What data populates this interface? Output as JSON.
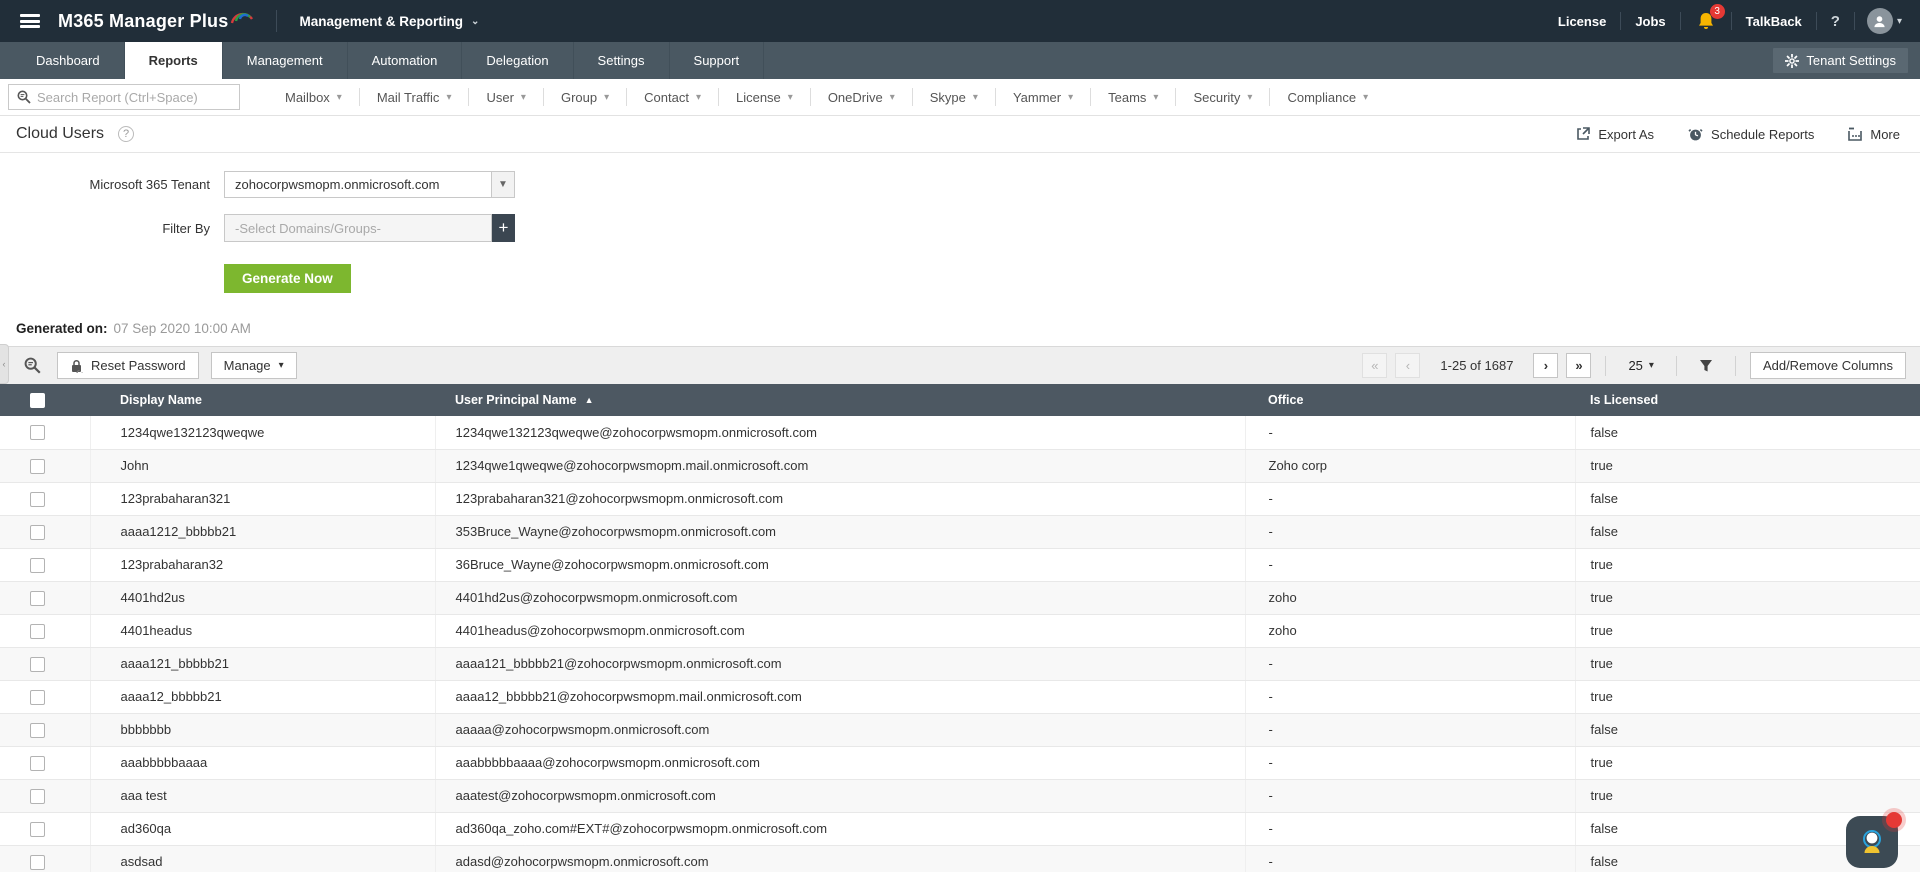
{
  "topbar": {
    "app_name": "M365 Manager Plus",
    "context_menu": "Management & Reporting",
    "license": "License",
    "jobs": "Jobs",
    "notification_count": "3",
    "talkback": "TalkBack",
    "help": "?"
  },
  "tabbar": {
    "tabs": [
      {
        "label": "Dashboard",
        "active": false
      },
      {
        "label": "Reports",
        "active": true
      },
      {
        "label": "Management",
        "active": false
      },
      {
        "label": "Automation",
        "active": false
      },
      {
        "label": "Delegation",
        "active": false
      },
      {
        "label": "Settings",
        "active": false
      },
      {
        "label": "Support",
        "active": false
      }
    ],
    "tenant_settings": "Tenant Settings"
  },
  "menubar": {
    "search_placeholder": "Search Report (Ctrl+Space)",
    "menus": [
      "Mailbox",
      "Mail Traffic",
      "User",
      "Group",
      "Contact",
      "License",
      "OneDrive",
      "Skype",
      "Yammer",
      "Teams",
      "Security",
      "Compliance"
    ]
  },
  "page": {
    "title": "Cloud Users",
    "export_as": "Export As",
    "schedule_reports": "Schedule Reports",
    "more": "More"
  },
  "form": {
    "tenant_label": "Microsoft 365 Tenant",
    "tenant_value": "zohocorpwsmopm.onmicrosoft.com",
    "filter_label": "Filter By",
    "filter_placeholder": "-Select Domains/Groups-",
    "generate_button": "Generate Now"
  },
  "generated": {
    "label": "Generated on:",
    "value": "07 Sep 2020 10:00 AM"
  },
  "toolbar": {
    "reset_password": "Reset Password",
    "manage": "Manage",
    "pagination_info": "1-25 of 1687",
    "page_size": "25",
    "add_remove_columns": "Add/Remove Columns"
  },
  "table": {
    "columns": {
      "display_name": "Display Name",
      "user_principal_name": "User Principal Name",
      "office": "Office",
      "is_licensed": "Is Licensed"
    },
    "sorted_by": "User Principal Name",
    "sort_direction": "asc",
    "rows": [
      {
        "display_name": "1234qwe132123qweqwe",
        "user_principal_name": "1234qwe132123qweqwe@zohocorpwsmopm.onmicrosoft.com",
        "office": "-",
        "is_licensed": "false"
      },
      {
        "display_name": "John",
        "user_principal_name": "1234qwe1qweqwe@zohocorpwsmopm.mail.onmicrosoft.com",
        "office": "Zoho corp",
        "is_licensed": "true"
      },
      {
        "display_name": "123prabaharan321",
        "user_principal_name": "123prabaharan321@zohocorpwsmopm.onmicrosoft.com",
        "office": "-",
        "is_licensed": "false"
      },
      {
        "display_name": "aaaa1212_bbbbb21",
        "user_principal_name": "353Bruce_Wayne@zohocorpwsmopm.onmicrosoft.com",
        "office": "-",
        "is_licensed": "false"
      },
      {
        "display_name": "123prabaharan32",
        "user_principal_name": "36Bruce_Wayne@zohocorpwsmopm.onmicrosoft.com",
        "office": "-",
        "is_licensed": "true"
      },
      {
        "display_name": "4401hd2us",
        "user_principal_name": "4401hd2us@zohocorpwsmopm.onmicrosoft.com",
        "office": "zoho",
        "is_licensed": "true"
      },
      {
        "display_name": "4401headus",
        "user_principal_name": "4401headus@zohocorpwsmopm.onmicrosoft.com",
        "office": "zoho",
        "is_licensed": "true"
      },
      {
        "display_name": "aaaa121_bbbbb21",
        "user_principal_name": "aaaa121_bbbbb21@zohocorpwsmopm.onmicrosoft.com",
        "office": "-",
        "is_licensed": "true"
      },
      {
        "display_name": "aaaa12_bbbbb21",
        "user_principal_name": "aaaa12_bbbbb21@zohocorpwsmopm.mail.onmicrosoft.com",
        "office": "-",
        "is_licensed": "true"
      },
      {
        "display_name": "bbbbbbb",
        "user_principal_name": "aaaaa@zohocorpwsmopm.onmicrosoft.com",
        "office": "-",
        "is_licensed": "false"
      },
      {
        "display_name": "aaabbbbbaaaa",
        "user_principal_name": "aaabbbbbaaaa@zohocorpwsmopm.onmicrosoft.com",
        "office": "-",
        "is_licensed": "true"
      },
      {
        "display_name": "aaa test",
        "user_principal_name": "aaatest@zohocorpwsmopm.onmicrosoft.com",
        "office": "-",
        "is_licensed": "true"
      },
      {
        "display_name": "ad360qa",
        "user_principal_name": "ad360qa_zoho.com#EXT#@zohocorpwsmopm.onmicrosoft.com",
        "office": "-",
        "is_licensed": "false"
      },
      {
        "display_name": "asdsad",
        "user_principal_name": "adasd@zohocorpwsmopm.onmicrosoft.com",
        "office": "-",
        "is_licensed": "false"
      }
    ]
  },
  "colors": {
    "topbar_bg": "#212e39",
    "tabbar_bg": "#4a5862",
    "table_header_bg": "#4d5862",
    "accent_green": "#7db72f",
    "bell_yellow": "#f7b500",
    "badge_red": "#e53935"
  }
}
